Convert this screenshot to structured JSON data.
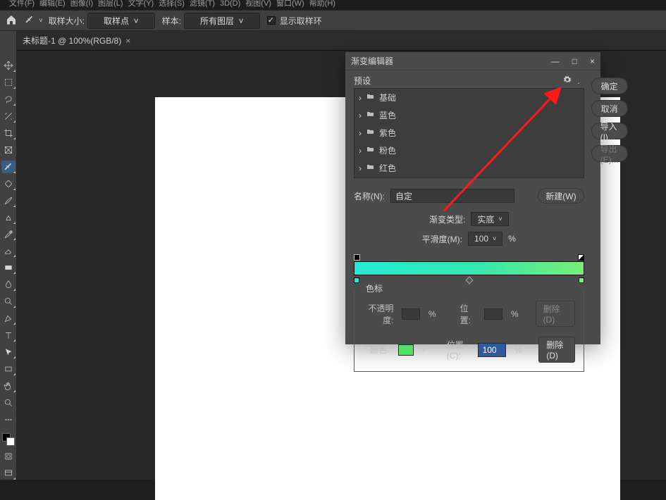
{
  "menu": [
    "文件(F)",
    "编辑(E)",
    "图像(I)",
    "图层(L)",
    "文字(Y)",
    "选择(S)",
    "滤镜(T)",
    "3D(D)",
    "视图(V)",
    "窗口(W)",
    "帮助(H)"
  ],
  "options": {
    "sample_size_label": "取样大小:",
    "sample_size_value": "取样点",
    "sample_label": "样本:",
    "sample_value": "所有图层",
    "show_ring": "显示取样环"
  },
  "document": {
    "tab": "未标题-1 @ 100%(RGB/8)",
    "close": "×"
  },
  "dialog": {
    "title": "渐变编辑器",
    "win": {
      "min": "—",
      "max": "□",
      "close": "×"
    },
    "presets_label": "预设",
    "preset_folders": [
      "基础",
      "蓝色",
      "紫色",
      "粉色",
      "红色"
    ],
    "ok": "确定",
    "cancel": "取消",
    "import": "导入(I)...",
    "export": "导出(E)...",
    "name_label": "名称(N):",
    "name_value": "自定",
    "new_btn": "新建(W)",
    "grad_type_label": "渐变类型:",
    "grad_type_value": "实底",
    "smooth_label": "平滑度(M):",
    "smooth_value": "100",
    "percent": "%",
    "stops_title": "色标",
    "opacity_label": "不透明度:",
    "pos_label_plain": "位置:",
    "delete_label": "删除(D)",
    "color_label": "颜色:",
    "pos_label": "位置(C):",
    "pos_value": "100",
    "color_value_hex": "#55e168",
    "chart_data": {
      "type": "gradient",
      "stops": [
        {
          "color": "#25ead4",
          "position": 0
        },
        {
          "color": "#77ee76",
          "position": 100
        }
      ],
      "opacity_stops": [
        {
          "opacity": 100,
          "position": 0
        },
        {
          "opacity": 100,
          "position": 100
        }
      ],
      "midpoints": [
        50
      ]
    }
  }
}
